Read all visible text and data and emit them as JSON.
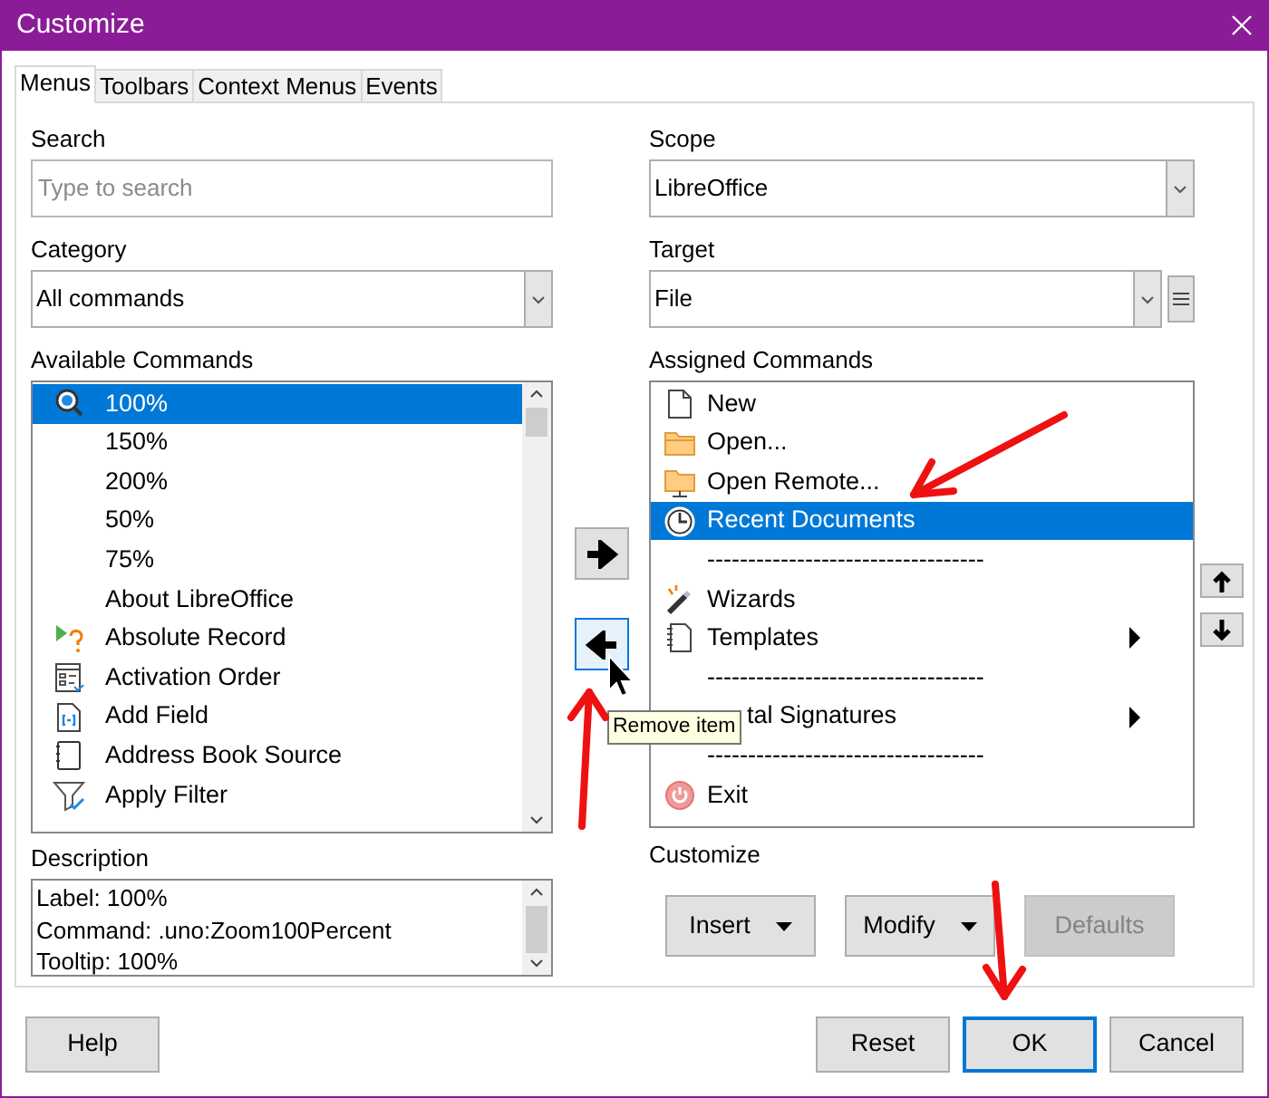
{
  "window": {
    "title": "Customize"
  },
  "tabs": [
    {
      "label": "Menus",
      "selected": true
    },
    {
      "label": "Toolbars",
      "selected": false
    },
    {
      "label": "Context Menus",
      "selected": false
    },
    {
      "label": "Events",
      "selected": false
    }
  ],
  "search": {
    "label": "Search",
    "placeholder": "Type to search"
  },
  "category": {
    "label": "Category",
    "value": "All commands"
  },
  "available": {
    "label": "Available Commands",
    "items": [
      {
        "text": "100%",
        "kind": "zoom",
        "selected": true
      },
      {
        "text": "150%",
        "kind": "plain",
        "selected": false
      },
      {
        "text": "200%",
        "kind": "plain",
        "selected": false
      },
      {
        "text": "50%",
        "kind": "plain",
        "selected": false
      },
      {
        "text": "75%",
        "kind": "plain",
        "selected": false
      },
      {
        "text": "About LibreOffice",
        "kind": "plain",
        "selected": false
      },
      {
        "text": "Absolute Record",
        "kind": "record",
        "selected": false
      },
      {
        "text": "Activation Order",
        "kind": "form",
        "selected": false
      },
      {
        "text": "Add Field",
        "kind": "field",
        "selected": false
      },
      {
        "text": "Address Book Source",
        "kind": "book",
        "selected": false
      },
      {
        "text": "Apply Filter",
        "kind": "filter",
        "selected": false
      }
    ]
  },
  "description": {
    "label": "Description",
    "lines": [
      "Label: 100%",
      "Command: .uno:Zoom100Percent",
      "Tooltip: 100%"
    ]
  },
  "scope": {
    "label": "Scope",
    "value": "LibreOffice"
  },
  "target": {
    "label": "Target",
    "value": "File"
  },
  "assigned": {
    "label": "Assigned Commands",
    "items": [
      {
        "text": "New",
        "kind": "document",
        "selected": false,
        "submenu": false
      },
      {
        "text": "Open...",
        "kind": "folder",
        "selected": false,
        "submenu": false
      },
      {
        "text": "Open Remote...",
        "kind": "remote",
        "selected": false,
        "submenu": false
      },
      {
        "text": "Recent Documents",
        "kind": "clock",
        "selected": true,
        "submenu": false
      },
      {
        "text": "----------------------------------",
        "kind": "separator",
        "selected": false,
        "submenu": false
      },
      {
        "text": "Wizards",
        "kind": "wand",
        "selected": false,
        "submenu": false
      },
      {
        "text": "Templates",
        "kind": "notebook",
        "selected": false,
        "submenu": true
      },
      {
        "text": "----------------------------------",
        "kind": "separator",
        "selected": false,
        "submenu": false
      },
      {
        "text": "tal Signatures",
        "kind": "covered",
        "selected": false,
        "submenu": true
      },
      {
        "text": "----------------------------------",
        "kind": "separator",
        "selected": false,
        "submenu": false
      },
      {
        "text": "Exit",
        "kind": "power",
        "selected": false,
        "submenu": false
      }
    ]
  },
  "move_buttons": [
    {
      "kind": "add",
      "hovered": false
    },
    {
      "kind": "remove",
      "hovered": true
    }
  ],
  "tooltip": {
    "text": "Remove item"
  },
  "customize": {
    "label": "Customize",
    "buttons": [
      {
        "label": "Insert",
        "dropdown": true,
        "disabled": false
      },
      {
        "label": "Modify",
        "dropdown": true,
        "disabled": false
      },
      {
        "label": "Defaults",
        "dropdown": false,
        "disabled": true
      }
    ]
  },
  "dialog_buttons": [
    {
      "label": "Help",
      "default": false
    },
    {
      "label": "Reset",
      "default": false
    },
    {
      "label": "OK",
      "default": true
    },
    {
      "label": "Cancel",
      "default": false
    }
  ]
}
